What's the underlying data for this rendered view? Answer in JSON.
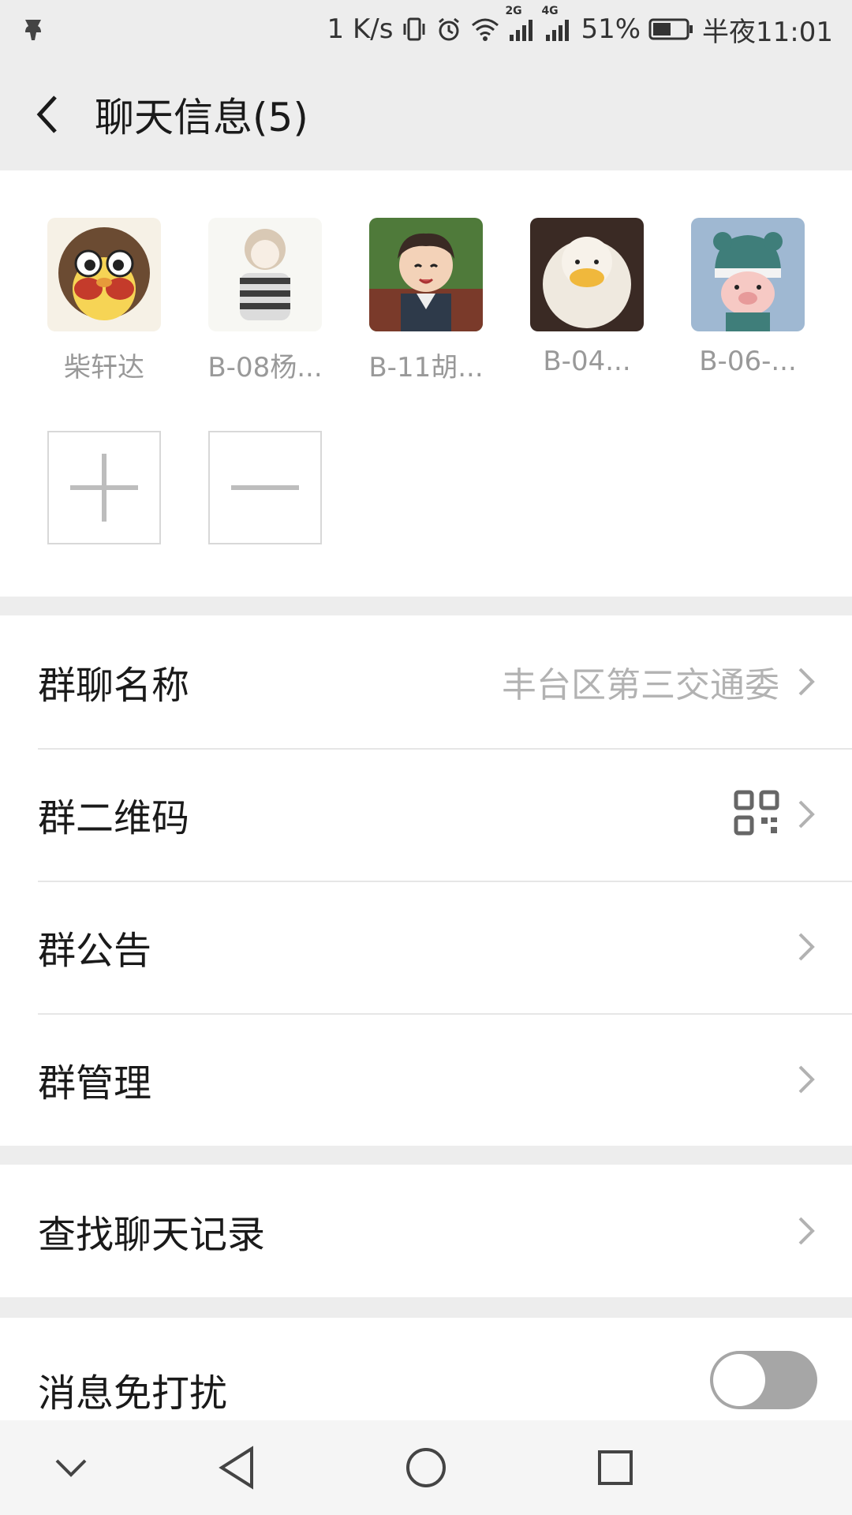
{
  "status_bar": {
    "network_speed": "1 K/s",
    "signal_2g": "2G",
    "signal_4g": "4G",
    "battery_percent": "51%",
    "time": "半夜11:01"
  },
  "header": {
    "title": "聊天信息(5)"
  },
  "members": [
    {
      "name": "柴轩达",
      "icon": "avatar-curly-hair-duck"
    },
    {
      "name": "B-08杨...",
      "icon": "avatar-sketch-boy"
    },
    {
      "name": "B-11胡...",
      "icon": "avatar-anime-boy"
    },
    {
      "name": "B-04...",
      "icon": "avatar-white-duck"
    },
    {
      "name": "B-06-...",
      "icon": "avatar-pig-hat"
    }
  ],
  "settings": {
    "group_name_label": "群聊名称",
    "group_name_value": "丰台区第三交通委",
    "qr_label": "群二维码",
    "notice_label": "群公告",
    "manage_label": "群管理",
    "search_label": "查找聊天记录",
    "mute_label": "消息免打扰",
    "mute_on": false
  },
  "colors": {
    "background": "#ededed",
    "panel": "#ffffff",
    "secondary_text": "#b2b2b2",
    "toggle_off": "#a6a6a6"
  }
}
